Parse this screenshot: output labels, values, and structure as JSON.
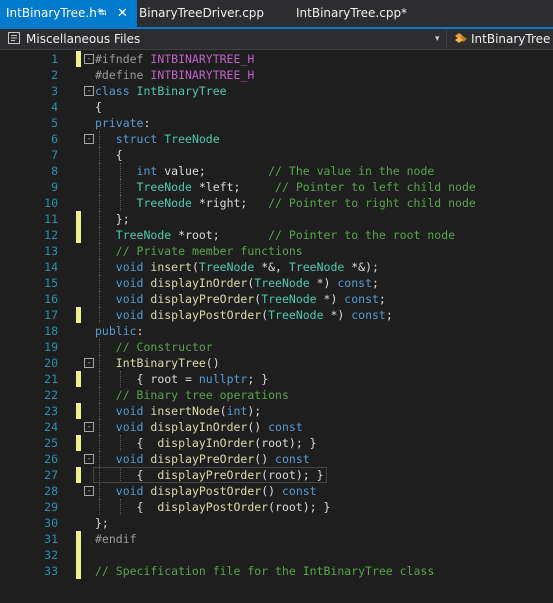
{
  "tabs": [
    {
      "label": "IntBinaryTree.h*",
      "active": true,
      "pin_icon": "pin-icon",
      "close_icon": "close-icon"
    },
    {
      "label": "BinaryTreeDriver.cpp",
      "active": false
    },
    {
      "label": "IntBinaryTree.cpp*",
      "active": false
    }
  ],
  "navbar": {
    "project_scope": "Miscellaneous Files",
    "member_scope": "IntBinaryTree"
  },
  "colors": {
    "accent": "#007acc",
    "editor_bg": "#1e1e1e",
    "line_number": "#2b91af",
    "keyword": "#569cd6",
    "type": "#4ec9b0",
    "comment": "#57a64a",
    "function": "#dcdcaa",
    "macro": "#bd63c5",
    "change_marker": "#efef91"
  },
  "editor": {
    "lines": [
      {
        "n": "1",
        "fold": "-",
        "changed": true,
        "guides": 0,
        "tokens": [
          [
            "pp",
            "#ifndef "
          ],
          [
            "mac",
            "INTBINARYTREE_H"
          ]
        ]
      },
      {
        "n": "2",
        "fold": "",
        "changed": false,
        "guides": 0,
        "tokens": [
          [
            "pp",
            "#define "
          ],
          [
            "mac",
            "INTBINARYTREE_H"
          ]
        ]
      },
      {
        "n": "3",
        "fold": "-",
        "changed": false,
        "guides": 0,
        "tokens": [
          [
            "kw",
            "class "
          ],
          [
            "ty",
            "IntBinaryTree"
          ]
        ]
      },
      {
        "n": "4",
        "fold": "",
        "changed": false,
        "guides": 0,
        "tokens": [
          [
            "tx",
            "{"
          ]
        ]
      },
      {
        "n": "5",
        "fold": "",
        "changed": false,
        "guides": 0,
        "tokens": [
          [
            "kw",
            "private"
          ],
          [
            "tx",
            ":"
          ]
        ]
      },
      {
        "n": "6",
        "fold": "-",
        "changed": false,
        "guides": 1,
        "tokens": [
          [
            "tx",
            "   "
          ],
          [
            "kw",
            "struct "
          ],
          [
            "ty",
            "TreeNode"
          ]
        ]
      },
      {
        "n": "7",
        "fold": "",
        "changed": false,
        "guides": 1,
        "tokens": [
          [
            "tx",
            "   {"
          ]
        ]
      },
      {
        "n": "8",
        "fold": "",
        "changed": false,
        "guides": 2,
        "tokens": [
          [
            "tx",
            "      "
          ],
          [
            "kw",
            "int "
          ],
          [
            "va",
            "value"
          ],
          [
            "tx",
            ";         "
          ],
          [
            "cm",
            "// The value in the node"
          ]
        ]
      },
      {
        "n": "9",
        "fold": "",
        "changed": false,
        "guides": 2,
        "tokens": [
          [
            "tx",
            "      "
          ],
          [
            "ty",
            "TreeNode "
          ],
          [
            "tx",
            "*"
          ],
          [
            "va",
            "left"
          ],
          [
            "tx",
            ";     "
          ],
          [
            "cm",
            "// Pointer to left child node"
          ]
        ]
      },
      {
        "n": "10",
        "fold": "",
        "changed": false,
        "guides": 2,
        "tokens": [
          [
            "tx",
            "      "
          ],
          [
            "ty",
            "TreeNode "
          ],
          [
            "tx",
            "*"
          ],
          [
            "va",
            "right"
          ],
          [
            "tx",
            ";   "
          ],
          [
            "cm",
            "// Pointer to right child node"
          ]
        ]
      },
      {
        "n": "11",
        "fold": "",
        "changed": true,
        "guides": 1,
        "tokens": [
          [
            "tx",
            "   };"
          ]
        ]
      },
      {
        "n": "12",
        "fold": "",
        "changed": true,
        "guides": 1,
        "tokens": [
          [
            "tx",
            "   "
          ],
          [
            "ty",
            "TreeNode "
          ],
          [
            "tx",
            "*"
          ],
          [
            "va",
            "root"
          ],
          [
            "tx",
            ";       "
          ],
          [
            "cm",
            "// Pointer to the root node"
          ]
        ]
      },
      {
        "n": "13",
        "fold": "",
        "changed": false,
        "guides": 1,
        "tokens": [
          [
            "tx",
            "   "
          ],
          [
            "cm",
            "// Private member functions"
          ]
        ]
      },
      {
        "n": "14",
        "fold": "",
        "changed": false,
        "guides": 1,
        "tokens": [
          [
            "tx",
            "   "
          ],
          [
            "kw",
            "void "
          ],
          [
            "fn",
            "insert"
          ],
          [
            "tx",
            "("
          ],
          [
            "ty",
            "TreeNode "
          ],
          [
            "tx",
            "*&, "
          ],
          [
            "ty",
            "TreeNode "
          ],
          [
            "tx",
            "*&);"
          ]
        ]
      },
      {
        "n": "15",
        "fold": "",
        "changed": false,
        "guides": 1,
        "tokens": [
          [
            "tx",
            "   "
          ],
          [
            "kw",
            "void "
          ],
          [
            "fn",
            "displayInOrder"
          ],
          [
            "tx",
            "("
          ],
          [
            "ty",
            "TreeNode "
          ],
          [
            "tx",
            "*) "
          ],
          [
            "kw",
            "const"
          ],
          [
            "tx",
            ";"
          ]
        ]
      },
      {
        "n": "16",
        "fold": "",
        "changed": false,
        "guides": 1,
        "tokens": [
          [
            "tx",
            "   "
          ],
          [
            "kw",
            "void "
          ],
          [
            "fn",
            "displayPreOrder"
          ],
          [
            "tx",
            "("
          ],
          [
            "ty",
            "TreeNode "
          ],
          [
            "tx",
            "*) "
          ],
          [
            "kw",
            "const"
          ],
          [
            "tx",
            ";"
          ]
        ]
      },
      {
        "n": "17",
        "fold": "",
        "changed": true,
        "guides": 1,
        "tokens": [
          [
            "tx",
            "   "
          ],
          [
            "kw",
            "void "
          ],
          [
            "fn",
            "displayPostOrder"
          ],
          [
            "tx",
            "("
          ],
          [
            "ty",
            "TreeNode "
          ],
          [
            "tx",
            "*) "
          ],
          [
            "kw",
            "const"
          ],
          [
            "tx",
            ";"
          ]
        ]
      },
      {
        "n": "18",
        "fold": "",
        "changed": false,
        "guides": 0,
        "tokens": [
          [
            "kw",
            "public"
          ],
          [
            "tx",
            ":"
          ]
        ]
      },
      {
        "n": "19",
        "fold": "",
        "changed": false,
        "guides": 1,
        "tokens": [
          [
            "tx",
            "   "
          ],
          [
            "cm",
            "// Constructor"
          ]
        ]
      },
      {
        "n": "20",
        "fold": "-",
        "changed": false,
        "guides": 1,
        "tokens": [
          [
            "tx",
            "   "
          ],
          [
            "fn",
            "IntBinaryTree"
          ],
          [
            "tx",
            "()"
          ]
        ]
      },
      {
        "n": "21",
        "fold": "",
        "changed": true,
        "guides": 2,
        "tokens": [
          [
            "tx",
            "      { "
          ],
          [
            "va",
            "root"
          ],
          [
            "tx",
            " = "
          ],
          [
            "kw",
            "nullptr"
          ],
          [
            "tx",
            "; }"
          ]
        ]
      },
      {
        "n": "22",
        "fold": "",
        "changed": false,
        "guides": 1,
        "tokens": [
          [
            "tx",
            "   "
          ],
          [
            "cm",
            "// Binary tree operations"
          ]
        ]
      },
      {
        "n": "23",
        "fold": "",
        "changed": true,
        "guides": 1,
        "tokens": [
          [
            "tx",
            "   "
          ],
          [
            "kw",
            "void "
          ],
          [
            "fn",
            "insertNode"
          ],
          [
            "tx",
            "("
          ],
          [
            "kw",
            "int"
          ],
          [
            "tx",
            ");"
          ]
        ]
      },
      {
        "n": "24",
        "fold": "-",
        "changed": false,
        "guides": 1,
        "tokens": [
          [
            "tx",
            "   "
          ],
          [
            "kw",
            "void "
          ],
          [
            "fn",
            "displayInOrder"
          ],
          [
            "tx",
            "() "
          ],
          [
            "kw",
            "const"
          ]
        ]
      },
      {
        "n": "25",
        "fold": "",
        "changed": true,
        "guides": 2,
        "tokens": [
          [
            "tx",
            "      {  "
          ],
          [
            "fn",
            "displayInOrder"
          ],
          [
            "tx",
            "("
          ],
          [
            "va",
            "root"
          ],
          [
            "tx",
            "); }"
          ]
        ]
      },
      {
        "n": "26",
        "fold": "-",
        "changed": false,
        "guides": 1,
        "tokens": [
          [
            "tx",
            "   "
          ],
          [
            "kw",
            "void "
          ],
          [
            "fn",
            "displayPreOrder"
          ],
          [
            "tx",
            "() "
          ],
          [
            "kw",
            "const"
          ]
        ]
      },
      {
        "n": "27",
        "fold": "",
        "changed": true,
        "guides": 2,
        "current": true,
        "tokens": [
          [
            "tx",
            "      {  "
          ],
          [
            "fn",
            "displayPreOrder"
          ],
          [
            "tx",
            "("
          ],
          [
            "va",
            "root"
          ],
          [
            "tx",
            "); }"
          ]
        ]
      },
      {
        "n": "28",
        "fold": "-",
        "changed": false,
        "guides": 1,
        "tokens": [
          [
            "tx",
            "   "
          ],
          [
            "kw",
            "void "
          ],
          [
            "fn",
            "displayPostOrder"
          ],
          [
            "tx",
            "() "
          ],
          [
            "kw",
            "const"
          ]
        ]
      },
      {
        "n": "29",
        "fold": "",
        "changed": false,
        "guides": 2,
        "tokens": [
          [
            "tx",
            "      {  "
          ],
          [
            "fn",
            "displayPostOrder"
          ],
          [
            "tx",
            "("
          ],
          [
            "va",
            "root"
          ],
          [
            "tx",
            "); }"
          ]
        ]
      },
      {
        "n": "30",
        "fold": "",
        "changed": false,
        "guides": 0,
        "tokens": [
          [
            "tx",
            "};"
          ]
        ]
      },
      {
        "n": "31",
        "fold": "",
        "changed": true,
        "guides": 0,
        "tokens": [
          [
            "pp",
            "#endif"
          ]
        ]
      },
      {
        "n": "32",
        "fold": "",
        "changed": true,
        "guides": 0,
        "tokens": []
      },
      {
        "n": "33",
        "fold": "",
        "changed": true,
        "guides": 0,
        "tokens": [
          [
            "cm",
            "// Specification file for the IntBinaryTree class"
          ]
        ]
      }
    ]
  }
}
